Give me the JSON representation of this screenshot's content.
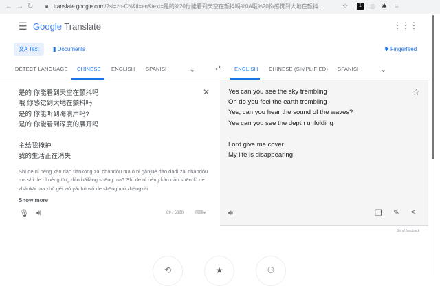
{
  "browser": {
    "url_host": "translate.google.com",
    "url_rest": "/?sl=zh-CN&tl=en&text=是的%20你能看到天空在颤抖吗%0A哦%20你感觉到大地在颤抖...",
    "ext_badge": "1"
  },
  "header": {
    "logo": "Google",
    "title": "Translate"
  },
  "modes": {
    "text": "Text",
    "documents": "Documents",
    "fingerfeed": "Fingerfeed"
  },
  "source_langs": [
    "DETECT LANGUAGE",
    "CHINESE",
    "ENGLISH",
    "SPANISH"
  ],
  "target_langs": [
    "ENGLISH",
    "CHINESE (SIMPLIFIED)",
    "SPANISH"
  ],
  "source_lines": [
    "是的 你能看到天空在颤抖吗",
    "哦 你感觉到大地在颤抖吗",
    "是的 你能听到海浪声吗?",
    "是的 你能看到深度的展开吗",
    "主给我掩护",
    "我的生活正在消失"
  ],
  "pinyin": "Shì de nǐ néng kàn dào tiānkōng zài chàndǒu ma ó nǐ gǎnjué dào dàdì zài chàndǒu ma shì de nǐ néng tīng dào hǎilàng shēng ma? Shì de nǐ néng kàn dào shēndù de zhǎnkāi ma zhǔ gěi wǒ yǎnhù wǒ de shēnghuó zhèngzài",
  "show_more": "Show more",
  "char_count": "69 / 5000",
  "target_lines": [
    "Yes can you see the sky trembling",
    "Oh do you feel the earth trembling",
    "Yes, can you hear the sound of the waves?",
    "Yes can you see the depth unfolding",
    "Lord give me cover",
    "My life is disappearing"
  ],
  "send_feedback": "Send feedback"
}
